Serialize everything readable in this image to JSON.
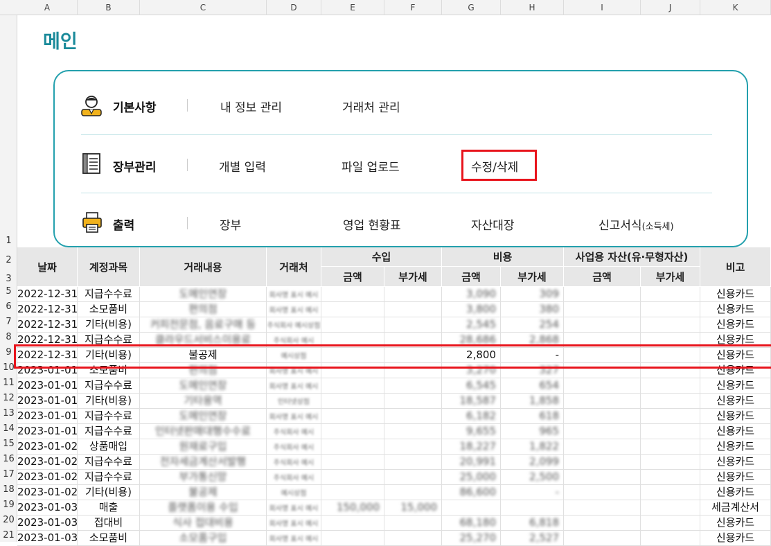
{
  "sheet": {
    "columns": [
      "A",
      "B",
      "C",
      "D",
      "E",
      "F",
      "G",
      "H",
      "I",
      "J",
      "K"
    ],
    "row_numbers": [
      "1",
      "2",
      "3",
      "5",
      "6",
      "7",
      "8",
      "9",
      "10",
      "11",
      "12",
      "13",
      "14",
      "15",
      "16",
      "17",
      "18",
      "19",
      "20",
      "21"
    ]
  },
  "title": "메인",
  "menu": {
    "groups": [
      {
        "icon": "person-icon",
        "label": "기본사항",
        "items": [
          "내 정보 관리",
          "거래처 관리"
        ]
      },
      {
        "icon": "ledger-icon",
        "label": "장부관리",
        "items": [
          "개별 입력",
          "파일 업로드",
          "수정/삭제"
        ]
      },
      {
        "icon": "printer-icon",
        "label": "출력",
        "items": [
          "장부",
          "영업 현황표",
          "자산대장",
          "신고서식"
        ],
        "last_suffix": "(소득세)"
      }
    ]
  },
  "table": {
    "headers": {
      "date": "날짜",
      "account": "계정과목",
      "description": "거래내용",
      "vendor": "거래처",
      "income": "수입",
      "expense": "비용",
      "asset": "사업용 자산(유·무형자산)",
      "note": "비고",
      "amount": "금액",
      "vat": "부가세"
    },
    "rows": [
      [
        "2022-12-31",
        "지급수수료",
        "도메인연장",
        "회사명 표시 예시",
        "",
        "",
        "3,090",
        "309",
        "",
        "",
        "신용카드"
      ],
      [
        "2022-12-31",
        "소모품비",
        "편의점",
        "회사명 표시 예시",
        "",
        "",
        "3,800",
        "380",
        "",
        "",
        "신용카드"
      ],
      [
        "2022-12-31",
        "기타(비용)",
        "커피전문점, 음료구매 등",
        "주식회사 예시상점",
        "",
        "",
        "2,545",
        "254",
        "",
        "",
        "신용카드"
      ],
      [
        "2022-12-31",
        "지급수수료",
        "클라우드서비스이용료",
        "주식회사 예시",
        "",
        "",
        "28,686",
        "2,868",
        "",
        "",
        "신용카드"
      ],
      [
        "2022-12-31",
        "기타(비용)",
        "불공제",
        "예시상점",
        "",
        "",
        "2,800",
        "-",
        "",
        "",
        "신용카드"
      ],
      [
        "2023-01-01",
        "소모품비",
        "편의점",
        "회사명 표시 예시",
        "",
        "",
        "3,270",
        "327",
        "",
        "",
        "신용카드"
      ],
      [
        "2023-01-01",
        "지급수수료",
        "도메인연장",
        "회사명 표시 예시",
        "",
        "",
        "6,545",
        "654",
        "",
        "",
        "신용카드"
      ],
      [
        "2023-01-01",
        "기타(비용)",
        "기타용역",
        "인터넷상점",
        "",
        "",
        "18,587",
        "1,858",
        "",
        "",
        "신용카드"
      ],
      [
        "2023-01-01",
        "지급수수료",
        "도메인연장",
        "회사명 표시 예시",
        "",
        "",
        "6,182",
        "618",
        "",
        "",
        "신용카드"
      ],
      [
        "2023-01-01",
        "지급수수료",
        "인터넷판매대행수수료",
        "주식회사 예시",
        "",
        "",
        "9,655",
        "965",
        "",
        "",
        "신용카드"
      ],
      [
        "2023-01-02",
        "상품매입",
        "원재료구입",
        "주식회사 예시",
        "",
        "",
        "18,227",
        "1,822",
        "",
        "",
        "신용카드"
      ],
      [
        "2023-01-02",
        "지급수수료",
        "전자세금계산서발행",
        "주식회사 예시",
        "",
        "",
        "20,991",
        "2,099",
        "",
        "",
        "신용카드"
      ],
      [
        "2023-01-02",
        "지급수수료",
        "부가통신망",
        "주식회사 예시",
        "",
        "",
        "25,000",
        "2,500",
        "",
        "",
        "신용카드"
      ],
      [
        "2023-01-02",
        "기타(비용)",
        "불공제",
        "예시상점",
        "",
        "",
        "86,600",
        "-",
        "",
        "",
        "신용카드"
      ],
      [
        "2023-01-03",
        "매출",
        "플랫폼이용 수입",
        "회사명 표시 예시",
        "150,000",
        "15,000",
        "",
        "",
        "",
        "",
        "세금계산서"
      ],
      [
        "2023-01-03",
        "접대비",
        "식사 접대비용",
        "회사명 표시 예시",
        "",
        "",
        "68,180",
        "6,818",
        "",
        "",
        "신용카드"
      ],
      [
        "2023-01-03",
        "소모품비",
        "소모품구입",
        "회사명 표시 예시",
        "",
        "",
        "25,270",
        "2,527",
        "",
        "",
        "신용카드"
      ]
    ]
  },
  "colors": {
    "accent": "#1a8a9a",
    "box_border": "#23a0ad",
    "highlight": "#e8141c",
    "header_bg": "#e7e7e7"
  }
}
